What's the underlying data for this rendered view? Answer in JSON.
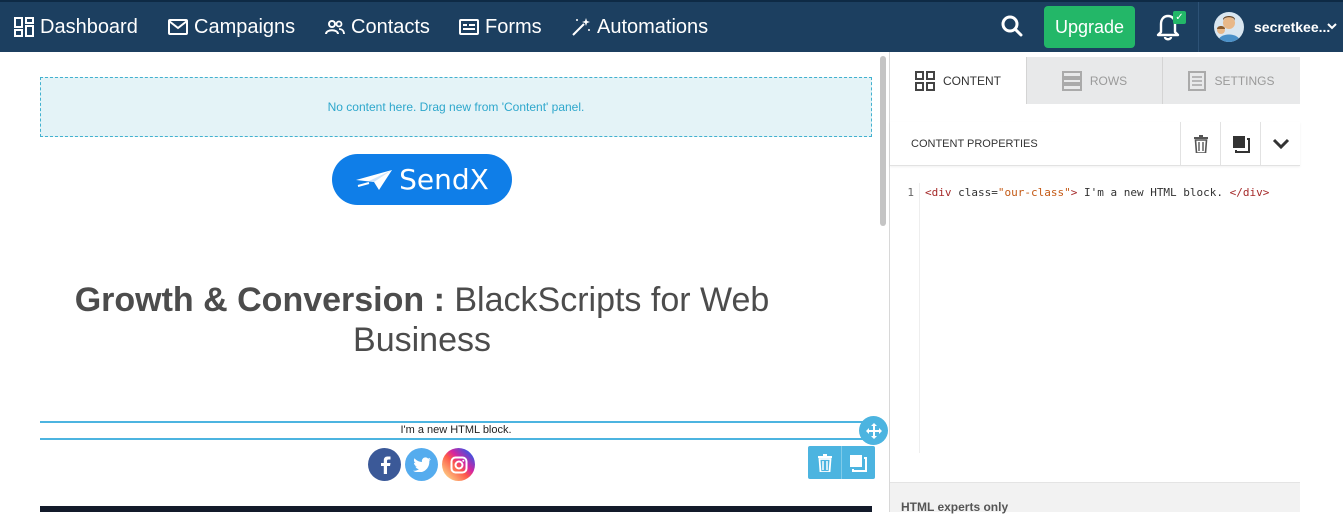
{
  "nav": {
    "items": [
      {
        "label": "Dashboard",
        "icon": "dashboard-icon"
      },
      {
        "label": "Campaigns",
        "icon": "envelope-icon"
      },
      {
        "label": "Contacts",
        "icon": "users-icon"
      },
      {
        "label": "Forms",
        "icon": "form-icon"
      },
      {
        "label": "Automations",
        "icon": "magic-wand-icon"
      }
    ],
    "upgrade_label": "Upgrade",
    "username": "secretkee...",
    "colors": {
      "nav_bg": "#1c3f60",
      "upgrade": "#23b768"
    }
  },
  "canvas": {
    "dropzone_text": "No content here. Drag new from 'Content' panel.",
    "logo_text": "SendX",
    "heading_bold": "Growth & Conversion :",
    "heading_rest": "BlackScripts for Web Business",
    "html_block_text": "I'm a new HTML block.",
    "social": [
      {
        "name": "facebook",
        "glyph": "f",
        "color": "#3b5998"
      },
      {
        "name": "twitter",
        "glyph": "t",
        "color": "#55acee"
      },
      {
        "name": "instagram",
        "glyph": "◎",
        "color": "#d6249f"
      }
    ]
  },
  "panel": {
    "tabs": [
      {
        "label": "CONTENT",
        "active": true
      },
      {
        "label": "ROWS",
        "active": false
      },
      {
        "label": "SETTINGS",
        "active": false
      }
    ],
    "properties_title": "CONTENT PROPERTIES",
    "code": {
      "line_number": "1",
      "open_tag": "<div",
      "attr_name": " class=",
      "attr_value": "\"our-class\"",
      "open_close": ">",
      "text": " I'm a new HTML block. ",
      "close_tag": "</div>"
    },
    "footer_text": "HTML experts only"
  }
}
